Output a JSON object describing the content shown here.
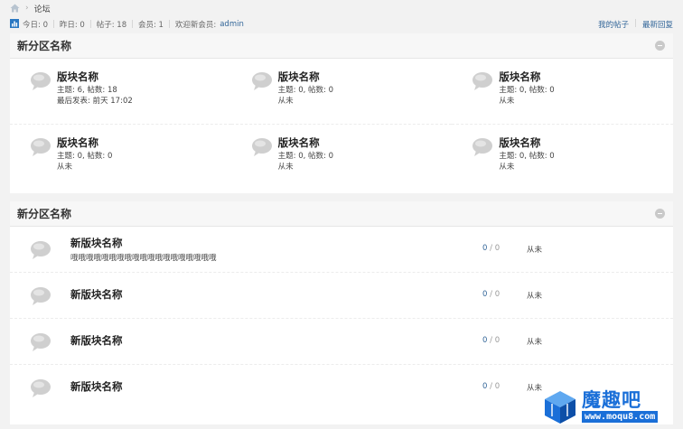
{
  "breadcrumb": {
    "current": "论坛",
    "separator": "›"
  },
  "stats": {
    "today": "今日: 0",
    "yesterday": "昨日: 0",
    "posts": "帖子: 18",
    "members": "会员: 1",
    "welcome": "欢迎新会员:",
    "newest_member": "admin",
    "separator": "|"
  },
  "links": {
    "my_posts": "我的帖子",
    "separator": "|",
    "latest_replies": "最新回复"
  },
  "section1": {
    "title": "新分区名称",
    "forums": [
      {
        "name": "版块名称",
        "meta": "主题: 6, 帖数: 18",
        "last": "最后发表: 前天 17:02"
      },
      {
        "name": "版块名称",
        "meta": "主题: 0, 帖数: 0",
        "last": "从未"
      },
      {
        "name": "版块名称",
        "meta": "主题: 0, 帖数: 0",
        "last": "从未"
      },
      {
        "name": "版块名称",
        "meta": "主题: 0, 帖数: 0",
        "last": "从未"
      },
      {
        "name": "版块名称",
        "meta": "主题: 0, 帖数: 0",
        "last": "从未"
      },
      {
        "name": "版块名称",
        "meta": "主题: 0, 帖数: 0",
        "last": "从未"
      }
    ]
  },
  "section2": {
    "title": "新分区名称",
    "forums": [
      {
        "name": "新版块名称",
        "desc": "哦哦哦哦哦哦哦哦哦哦哦哦哦哦哦哦哦哦哦",
        "threads": "0",
        "sep": " / ",
        "posts": "0",
        "last": "从未"
      },
      {
        "name": "新版块名称",
        "threads": "0",
        "sep": " / ",
        "posts": "0",
        "last": "从未"
      },
      {
        "name": "新版块名称",
        "threads": "0",
        "sep": " / ",
        "posts": "0",
        "last": "从未"
      },
      {
        "name": "新版块名称",
        "threads": "0",
        "sep": " / ",
        "posts": "0",
        "last": "从未"
      }
    ]
  },
  "watermark": {
    "brand": "魔趣吧",
    "url": "www.moqu8.com"
  },
  "colors": {
    "link": "#336699",
    "header_bg": "#f7f7f7",
    "page_bg": "#f2f2f2",
    "watermark": "#1a6fd8"
  },
  "icons": [
    "home-icon",
    "stats-chart-icon",
    "collapse-icon",
    "forum-bubble-icon",
    "cube-logo-icon"
  ]
}
